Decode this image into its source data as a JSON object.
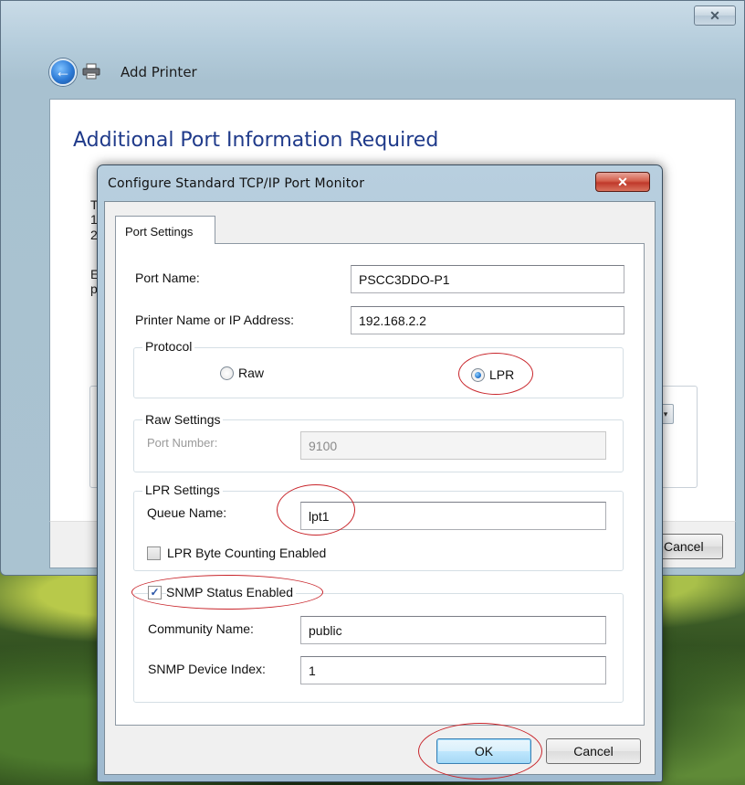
{
  "wizard": {
    "title": "Add Printer",
    "heading": "Additional Port Information Required",
    "partial_left_text": [
      "T",
      "1",
      "2",
      "E",
      "p"
    ],
    "cancel_label": "Cancel",
    "close_glyph": "✕"
  },
  "dialog": {
    "title": "Configure Standard TCP/IP Port Monitor",
    "close_glyph": "✕",
    "tab_label": "Port Settings",
    "port_name_label": "Port Name:",
    "port_name_value": "PSCC3DDO-P1",
    "printer_address_label": "Printer Name or IP Address:",
    "printer_address_value": "192.168.2.2",
    "protocol": {
      "group_label": "Protocol",
      "raw_label": "Raw",
      "lpr_label": "LPR",
      "selected": "LPR"
    },
    "raw_settings": {
      "group_label": "Raw Settings",
      "port_number_label": "Port Number:",
      "port_number_value": "9100"
    },
    "lpr_settings": {
      "group_label": "LPR Settings",
      "queue_name_label": "Queue Name:",
      "queue_name_value": "lpt1",
      "byte_counting_label": "LPR Byte Counting Enabled",
      "byte_counting_checked": false
    },
    "snmp": {
      "enabled_label": "SNMP Status Enabled",
      "enabled_checked": true,
      "community_name_label": "Community Name:",
      "community_name_value": "public",
      "device_index_label": "SNMP Device Index:",
      "device_index_value": "1"
    },
    "ok_label": "OK",
    "cancel_label": "Cancel"
  },
  "icons": {
    "back": "back-arrow-icon",
    "printer": "printer-icon",
    "dropdown": "chevron-down-icon",
    "check": "checkmark-icon"
  },
  "colors": {
    "heading_blue": "#1f3a8a",
    "annotation_red": "#c8242a",
    "close_red": "#c0392b",
    "default_button_border": "#3c7fb1"
  }
}
